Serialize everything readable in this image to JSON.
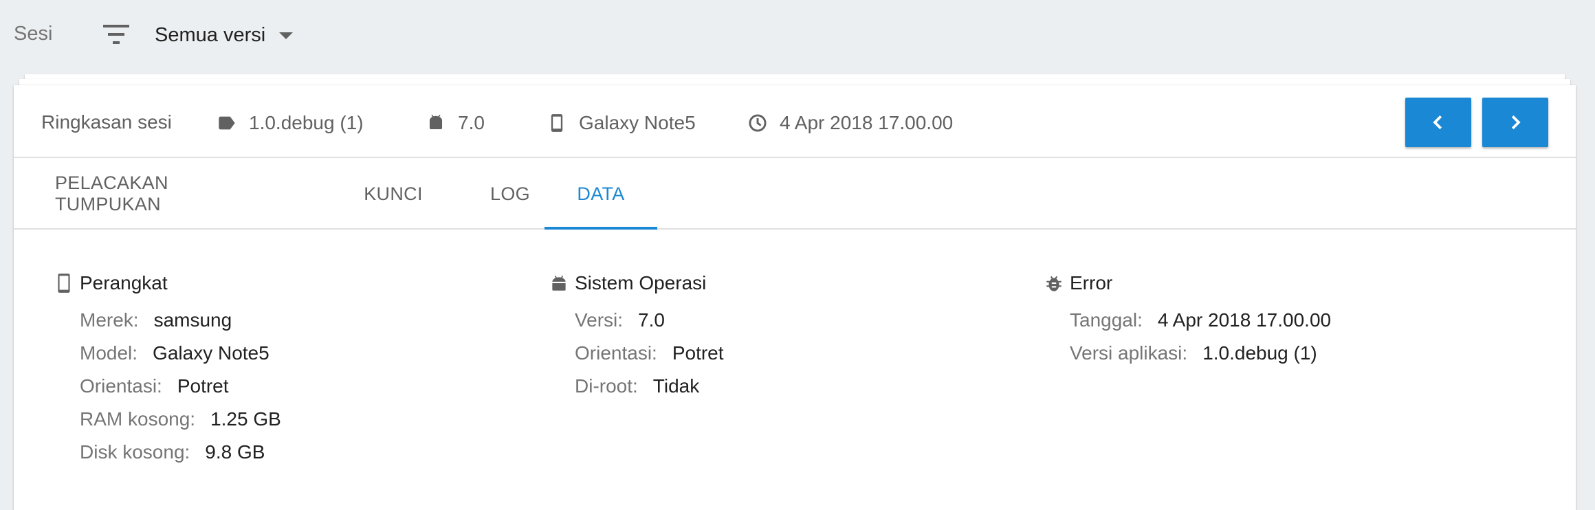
{
  "topbar": {
    "sesi_label": "Sesi",
    "filter_icon": "filter-icon",
    "version_select": "Semua versi"
  },
  "summary": {
    "title": "Ringkasan sesi",
    "version": "1.0.debug (1)",
    "os": "7.0",
    "device": "Galaxy Note5",
    "time": "4 Apr 2018 17.00.00",
    "icons": [
      "tag-icon",
      "android-icon",
      "phone-icon",
      "clock-icon"
    ],
    "prev_icon": "chevron-left-icon",
    "next_icon": "chevron-right-icon"
  },
  "tabs": [
    {
      "label": "PELACAKAN TUMPUKAN"
    },
    {
      "label": "KUNCI"
    },
    {
      "label": "LOG"
    },
    {
      "label": "DATA",
      "active": true
    }
  ],
  "sections": {
    "device": {
      "title": "Perangkat",
      "rows": [
        {
          "key": "Merek:",
          "value": "samsung"
        },
        {
          "key": "Model:",
          "value": "Galaxy Note5"
        },
        {
          "key": "Orientasi:",
          "value": "Potret"
        },
        {
          "key": "RAM kosong:",
          "value": "1.25 GB"
        },
        {
          "key": "Disk kosong:",
          "value": "9.8 GB"
        }
      ]
    },
    "os": {
      "title": "Sistem Operasi",
      "rows": [
        {
          "key": "Versi:",
          "value": "7.0"
        },
        {
          "key": "Orientasi:",
          "value": "Potret"
        },
        {
          "key": "Di-root:",
          "value": "Tidak"
        }
      ]
    },
    "error": {
      "title": "Error",
      "rows": [
        {
          "key": "Tanggal:",
          "value": "4 Apr 2018 17.00.00"
        },
        {
          "key": "Versi aplikasi:",
          "value": "1.0.debug (1)"
        }
      ]
    }
  },
  "colors": {
    "accent": "#1a88d4",
    "background": "#eceff1"
  }
}
